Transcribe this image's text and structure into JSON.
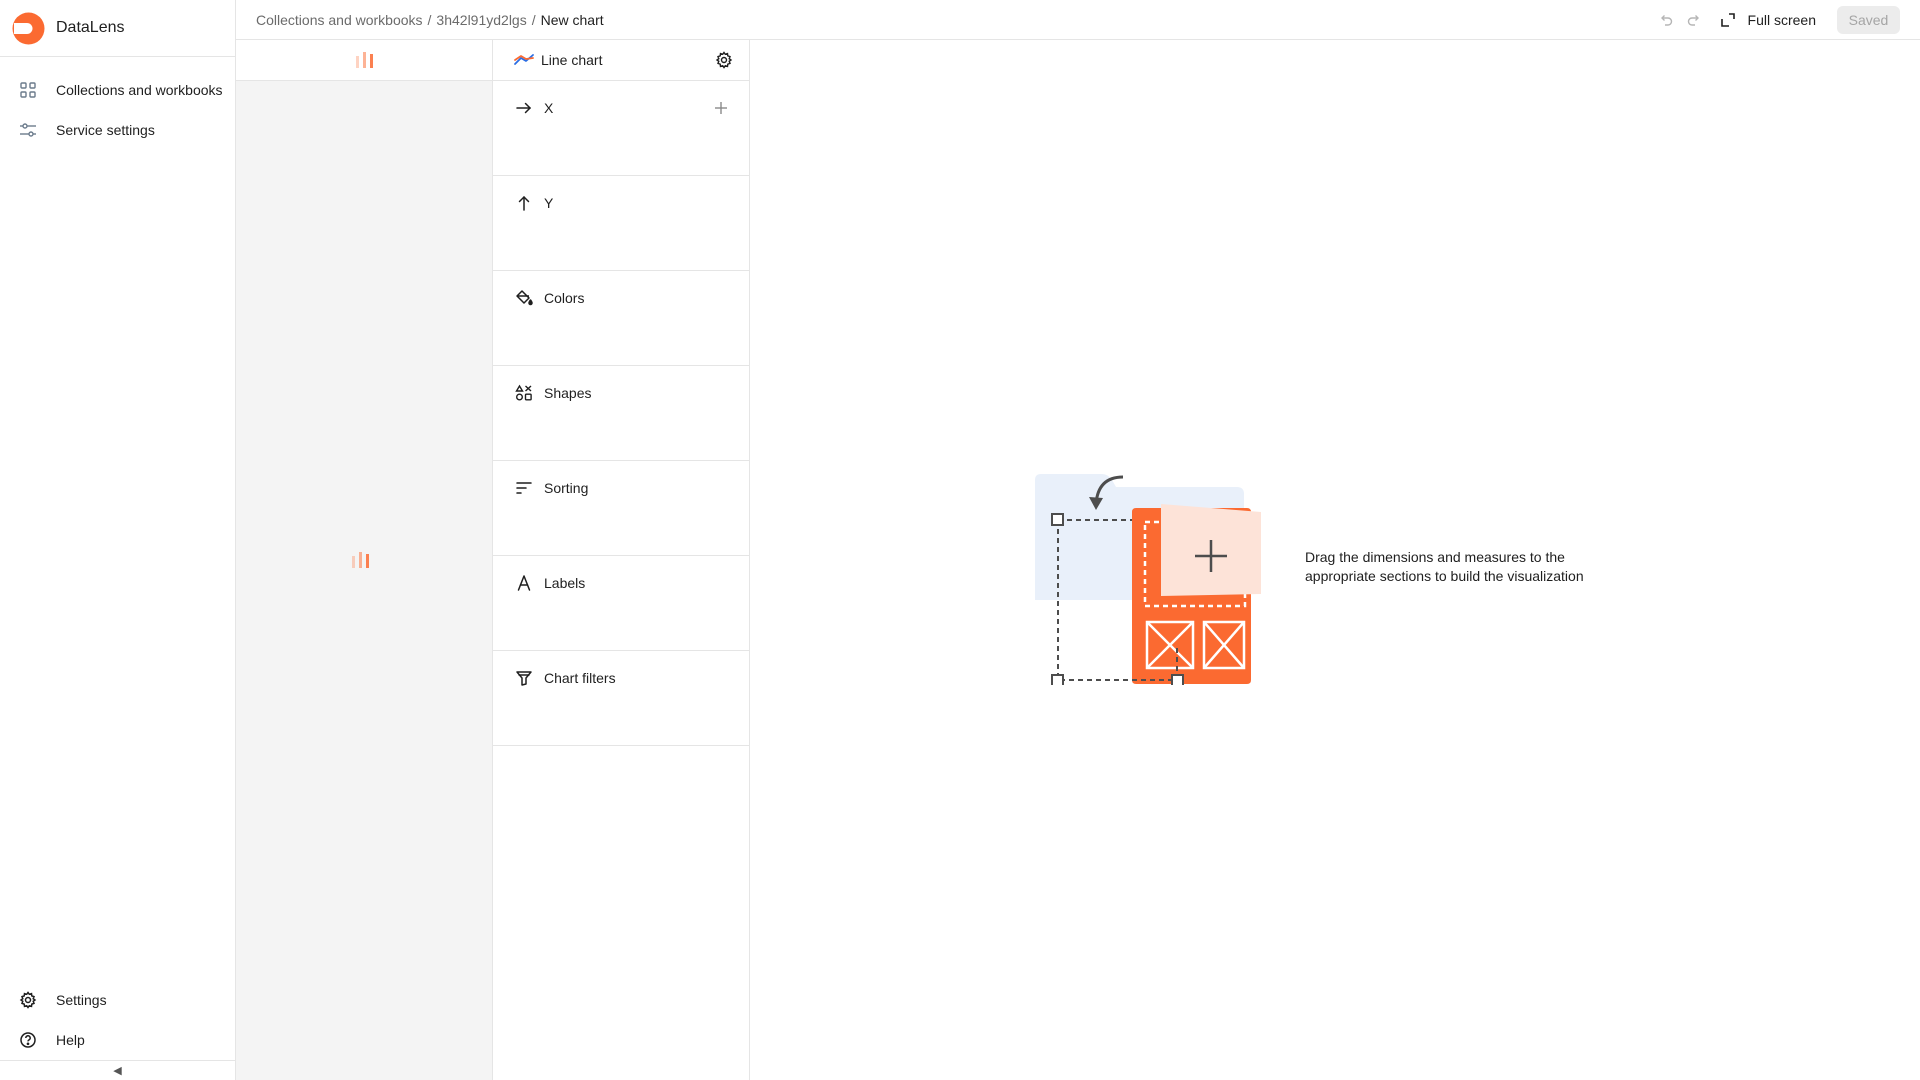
{
  "nav": {
    "app_title": "DataLens",
    "items": [
      {
        "label": "Collections and workbooks",
        "icon": "grid-icon"
      },
      {
        "label": "Service settings",
        "icon": "sliders-icon"
      }
    ],
    "bottom_items": [
      {
        "label": "Settings",
        "icon": "gear-icon"
      },
      {
        "label": "Help",
        "icon": "help-circle-icon"
      }
    ],
    "collapse_glyph": "◀"
  },
  "breadcrumb": {
    "items": [
      "Collections and workbooks",
      "3h42l91yd2lgs"
    ],
    "separator": "/",
    "current": "New chart"
  },
  "toolbar": {
    "fullscreen_label": "Full screen",
    "saved_label": "Saved"
  },
  "visualization": {
    "type_label": "Line chart",
    "sections": [
      {
        "label": "X",
        "icon": "arrow-right-icon",
        "addable": true
      },
      {
        "label": "Y",
        "icon": "arrow-up-icon",
        "addable": false
      },
      {
        "label": "Colors",
        "icon": "paint-bucket-icon",
        "addable": false
      },
      {
        "label": "Shapes",
        "icon": "shapes-icon",
        "addable": false
      },
      {
        "label": "Sorting",
        "icon": "sort-lines-icon",
        "addable": false
      },
      {
        "label": "Labels",
        "icon": "letter-a-icon",
        "addable": false
      },
      {
        "label": "Chart filters",
        "icon": "funnel-icon",
        "addable": false
      }
    ]
  },
  "empty_state": {
    "message": "Drag the dimensions and measures to the appropriate sections to build the visualization"
  },
  "colors": {
    "brand": "#fb6a31",
    "brand_light": "#fde3d8",
    "folder_blue": "#e9f0fa",
    "panel_bg": "#f4f4f4",
    "border": "#e5e5e5"
  }
}
